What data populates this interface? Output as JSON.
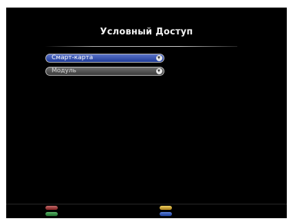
{
  "window": {
    "title": "Условный Доступ"
  },
  "menu": {
    "items": [
      {
        "label": "Смарт-карта",
        "selected": true
      },
      {
        "label": "Модуль",
        "selected": false
      }
    ]
  },
  "function_keys": [
    {
      "color": "red",
      "hex": "#a03a3a"
    },
    {
      "color": "green",
      "hex": "#2f8a3c"
    },
    {
      "color": "yellow",
      "hex": "#d4aa30"
    },
    {
      "color": "blue",
      "hex": "#2c52b8"
    }
  ]
}
